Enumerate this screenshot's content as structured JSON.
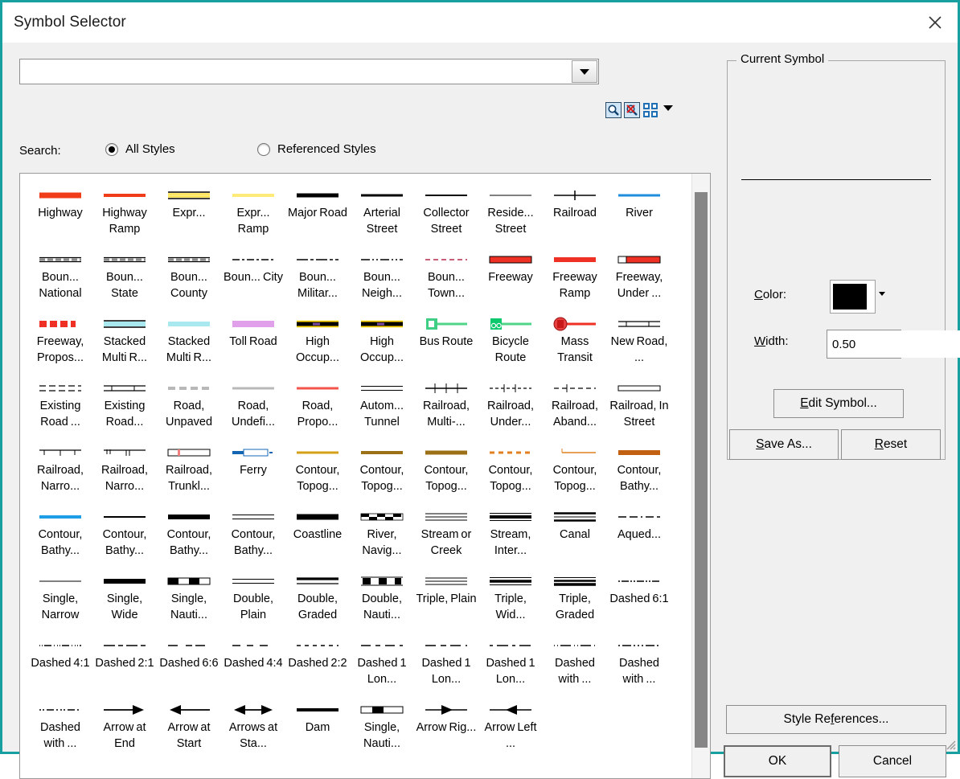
{
  "window": {
    "title": "Symbol Selector",
    "close_icon": "close-icon",
    "accent_color": "#189f9f"
  },
  "search": {
    "value": "",
    "placeholder": "",
    "dropdown_icon": "chevron-down-icon",
    "label": "Search:",
    "tools": [
      {
        "name": "search-icon",
        "title": "Search"
      },
      {
        "name": "clear-search-icon",
        "title": "Clear Search"
      },
      {
        "name": "view-grid-icon",
        "title": "View Options"
      },
      {
        "name": "view-menu-chevron-icon",
        "title": "More Views"
      }
    ],
    "radios": [
      {
        "label": "All Styles",
        "checked": true
      },
      {
        "label": "Referenced Styles",
        "checked": false
      }
    ]
  },
  "symbols": [
    {
      "label": "Highway",
      "style": "solid",
      "color": "#f03c18",
      "width": 7
    },
    {
      "label": "Highway Ramp",
      "style": "solid",
      "color": "#f03c18",
      "width": 4
    },
    {
      "label": "Expr...",
      "style": "multi-line",
      "color": "#ffe44d",
      "width": 7
    },
    {
      "label": "Expr... Ramp",
      "style": "solid",
      "color": "#ffeb7a",
      "width": 4
    },
    {
      "label": "Major Road",
      "style": "solid",
      "color": "#000000",
      "width": 5
    },
    {
      "label": "Arterial Street",
      "style": "solid",
      "color": "#000000",
      "width": 3
    },
    {
      "label": "Collector Street",
      "style": "solid",
      "color": "#000000",
      "width": 2
    },
    {
      "label": "Reside... Street",
      "style": "solid",
      "color": "#000000",
      "width": 1
    },
    {
      "label": "Railroad",
      "style": "rail",
      "color": "#000000",
      "width": 1
    },
    {
      "label": "River",
      "style": "solid",
      "color": "#1f8ddd",
      "width": 3
    },
    {
      "label": "Boun... National",
      "style": "dash-gray",
      "color": "#8a8a8a",
      "width": 5
    },
    {
      "label": "Boun... State",
      "style": "dash-gray",
      "color": "#8a8a8a",
      "width": 5
    },
    {
      "label": "Boun... County",
      "style": "dash-gray",
      "color": "#8a8a8a",
      "width": 4
    },
    {
      "label": "Boun... City",
      "style": "dash-dot",
      "color": "#000000",
      "width": 2
    },
    {
      "label": "Boun... Militar...",
      "style": "long-dash-dot",
      "color": "#000000",
      "width": 2
    },
    {
      "label": "Boun... Neigh...",
      "style": "dash-dot-dot",
      "color": "#000000",
      "width": 1
    },
    {
      "label": "Boun... Town...",
      "style": "dash-pink",
      "color": "#c9607a",
      "width": 2
    },
    {
      "label": "Freeway",
      "style": "cased",
      "color": "#ee3124",
      "width": 9
    },
    {
      "label": "Freeway Ramp",
      "style": "solid",
      "color": "#ee3124",
      "width": 6
    },
    {
      "label": "Freeway, Under ...",
      "style": "cased-gap",
      "color": "#ee3124",
      "width": 9
    },
    {
      "label": "Freeway, Propos...",
      "style": "dash-squares",
      "color": "#ee3124",
      "width": 8
    },
    {
      "label": "Stacked Multi R...",
      "style": "solid-cased",
      "color": "#a8e8ee",
      "width": 8
    },
    {
      "label": "Stacked Multi R...",
      "style": "solid",
      "color": "#a8e8ee",
      "width": 6
    },
    {
      "label": "Toll Road",
      "style": "solid",
      "color": "#e0a0ea",
      "width": 8
    },
    {
      "label": "High Occup...",
      "style": "hov",
      "color": "#ffd400",
      "width": 8
    },
    {
      "label": "High Occup...",
      "style": "hov",
      "color": "#ffd400",
      "width": 7
    },
    {
      "label": "Bus Route",
      "style": "bus",
      "color": "#4fd48a",
      "width": 4
    },
    {
      "label": "Bicycle Route",
      "style": "bike",
      "color": "#4fd48a",
      "width": 4
    },
    {
      "label": "Mass Transit",
      "style": "transit",
      "color": "#ee3124",
      "width": 4
    },
    {
      "label": "New Road, ...",
      "style": "triple-dash",
      "color": "#000000",
      "width": 1
    },
    {
      "label": "Existing Road ...",
      "style": "double-dash",
      "color": "#000000",
      "width": 1
    },
    {
      "label": "Existing Road...",
      "style": "triple-dash",
      "color": "#000000",
      "width": 1
    },
    {
      "label": "Road, Unpaved",
      "style": "gray-dash",
      "color": "#b8b8b8",
      "width": 4
    },
    {
      "label": "Road, Undefi...",
      "style": "gray-solid",
      "color": "#b8b8b8",
      "width": 3
    },
    {
      "label": "Road, Propo...",
      "style": "solid",
      "color": "#f3544b",
      "width": 3
    },
    {
      "label": "Autom... Tunnel",
      "style": "double-line",
      "color": "#000000",
      "width": 1
    },
    {
      "label": "Railroad, Multi-...",
      "style": "rail-multi",
      "color": "#000000",
      "width": 1
    },
    {
      "label": "Railroad, Under...",
      "style": "rail-tick",
      "color": "#000000",
      "width": 1
    },
    {
      "label": "Railroad, Aband...",
      "style": "rail-dash",
      "color": "#000000",
      "width": 1
    },
    {
      "label": "Railroad, In Street",
      "style": "rail-cased",
      "color": "#000000",
      "width": 1
    },
    {
      "label": "Railroad, Narro...",
      "style": "bracket",
      "color": "#000000",
      "width": 1
    },
    {
      "label": "Railroad, Narro...",
      "style": "bracket-tick",
      "color": "#000000",
      "width": 1
    },
    {
      "label": "Railroad, Trunkl...",
      "style": "cased-hollow",
      "color": "#f08080",
      "width": 1
    },
    {
      "label": "Ferry",
      "style": "cased-blue",
      "color": "#1464b4",
      "width": 1
    },
    {
      "label": "Contour, Topog...",
      "style": "solid",
      "color": "#d4a017",
      "width": 3
    },
    {
      "label": "Contour, Topog...",
      "style": "solid",
      "color": "#9c7016",
      "width": 4
    },
    {
      "label": "Contour, Topog...",
      "style": "solid",
      "color": "#9c7016",
      "width": 5
    },
    {
      "label": "Contour, Topog...",
      "style": "dash-orange",
      "color": "#e08020",
      "width": 3
    },
    {
      "label": "Contour, Topog...",
      "style": "tick-orange",
      "color": "#e08020",
      "width": 2
    },
    {
      "label": "Contour, Bathy...",
      "style": "solid",
      "color": "#c06010",
      "width": 6
    },
    {
      "label": "Contour, Bathy...",
      "style": "solid",
      "color": "#1f9ee8",
      "width": 4
    },
    {
      "label": "Contour, Bathy...",
      "style": "solid",
      "color": "#000000",
      "width": 2
    },
    {
      "label": "Contour, Bathy...",
      "style": "solid",
      "color": "#000000",
      "width": 6
    },
    {
      "label": "Contour, Bathy...",
      "style": "double-line",
      "color": "#000000",
      "width": 1
    },
    {
      "label": "Coastline",
      "style": "solid",
      "color": "#000000",
      "width": 7
    },
    {
      "label": "River, Navig...",
      "style": "checker",
      "color": "#000000",
      "width": 6
    },
    {
      "label": "Stream or Creek",
      "style": "triple-thin",
      "color": "#000000",
      "width": 1
    },
    {
      "label": "Stream, Inter...",
      "style": "triple-mixed",
      "color": "#000000",
      "width": 1
    },
    {
      "label": "Canal",
      "style": "triple-bold",
      "color": "#000000",
      "width": 1
    },
    {
      "label": "Aqued...",
      "style": "dash-long-dot",
      "color": "#000000",
      "width": 2
    },
    {
      "label": "Single, Narrow",
      "style": "solid",
      "color": "#000000",
      "width": 1
    },
    {
      "label": "Single, Wide",
      "style": "solid",
      "color": "#000000",
      "width": 6
    },
    {
      "label": "Single, Nauti...",
      "style": "checker-sm",
      "color": "#000000",
      "width": 7
    },
    {
      "label": "Double, Plain",
      "style": "double-line",
      "color": "#000000",
      "width": 1
    },
    {
      "label": "Double, Graded",
      "style": "double-bold",
      "color": "#000000",
      "width": 1
    },
    {
      "label": "Double, Nauti...",
      "style": "checker-double",
      "color": "#000000",
      "width": 1
    },
    {
      "label": "Triple, Plain",
      "style": "triple-thin",
      "color": "#000000",
      "width": 1
    },
    {
      "label": "Triple, Wid...",
      "style": "triple-bold2",
      "color": "#000000",
      "width": 1
    },
    {
      "label": "Triple, Graded",
      "style": "triple-graded",
      "color": "#000000",
      "width": 1
    },
    {
      "label": "Dashed 6:1",
      "style": "dash-6-1",
      "color": "#000000",
      "width": 2
    },
    {
      "label": "Dashed 4:1",
      "style": "dash-4-1",
      "color": "#000000",
      "width": 2
    },
    {
      "label": "Dashed 2:1",
      "style": "dash-2-1",
      "color": "#000000",
      "width": 2
    },
    {
      "label": "Dashed 6:6",
      "style": "dash-6-6",
      "color": "#000000",
      "width": 2
    },
    {
      "label": "Dashed 4:4",
      "style": "dash-4-4",
      "color": "#000000",
      "width": 2
    },
    {
      "label": "Dashed 2:2",
      "style": "dash-2-2",
      "color": "#000000",
      "width": 2
    },
    {
      "label": "Dashed 1 Lon...",
      "style": "dash-long-1",
      "color": "#000000",
      "width": 2
    },
    {
      "label": "Dashed 1 Lon...",
      "style": "dash-long-2",
      "color": "#000000",
      "width": 2
    },
    {
      "label": "Dashed 1 Lon...",
      "style": "dash-long-3",
      "color": "#000000",
      "width": 2
    },
    {
      "label": "Dashed with ...",
      "style": "dash-dot-dot2",
      "color": "#000000",
      "width": 2
    },
    {
      "label": "Dashed with ...",
      "style": "dash-dot-dash",
      "color": "#000000",
      "width": 2
    },
    {
      "label": "Dashed with ...",
      "style": "dash-sparse",
      "color": "#000000",
      "width": 2
    },
    {
      "label": "Arrow at End",
      "style": "arrow-end",
      "color": "#000000",
      "width": 2
    },
    {
      "label": "Arrow at Start",
      "style": "arrow-start",
      "color": "#000000",
      "width": 2
    },
    {
      "label": "Arrows at Sta...",
      "style": "arrow-both",
      "color": "#000000",
      "width": 2
    },
    {
      "label": "Dam",
      "style": "solid",
      "color": "#000000",
      "width": 4
    },
    {
      "label": "Single, Nauti...",
      "style": "checker-sm2",
      "color": "#000000",
      "width": 6
    },
    {
      "label": "Arrow Rig...",
      "style": "arrow-mid-right",
      "color": "#000000",
      "width": 2
    },
    {
      "label": "Arrow Left ...",
      "style": "arrow-mid-left",
      "color": "#000000",
      "width": 2
    }
  ],
  "current_symbol": {
    "legend": "Current Symbol",
    "preview_color": "#000000",
    "color_label": "Color:",
    "color_value": "#000000",
    "width_label": "Width:",
    "width_value": "0.50",
    "buttons": {
      "edit_symbol": "Edit Symbol...",
      "edit_symbol_accel": "E",
      "save_as": "Save As...",
      "save_as_accel": "S",
      "reset": "Reset",
      "reset_accel": "R"
    }
  },
  "footer": {
    "style_references": "Style References...",
    "style_references_accel": "f",
    "ok": "OK",
    "cancel": "Cancel"
  },
  "scrollbar": {
    "orientation": "vertical",
    "thumb_position_percent": 3,
    "thumb_size_percent": 92
  }
}
